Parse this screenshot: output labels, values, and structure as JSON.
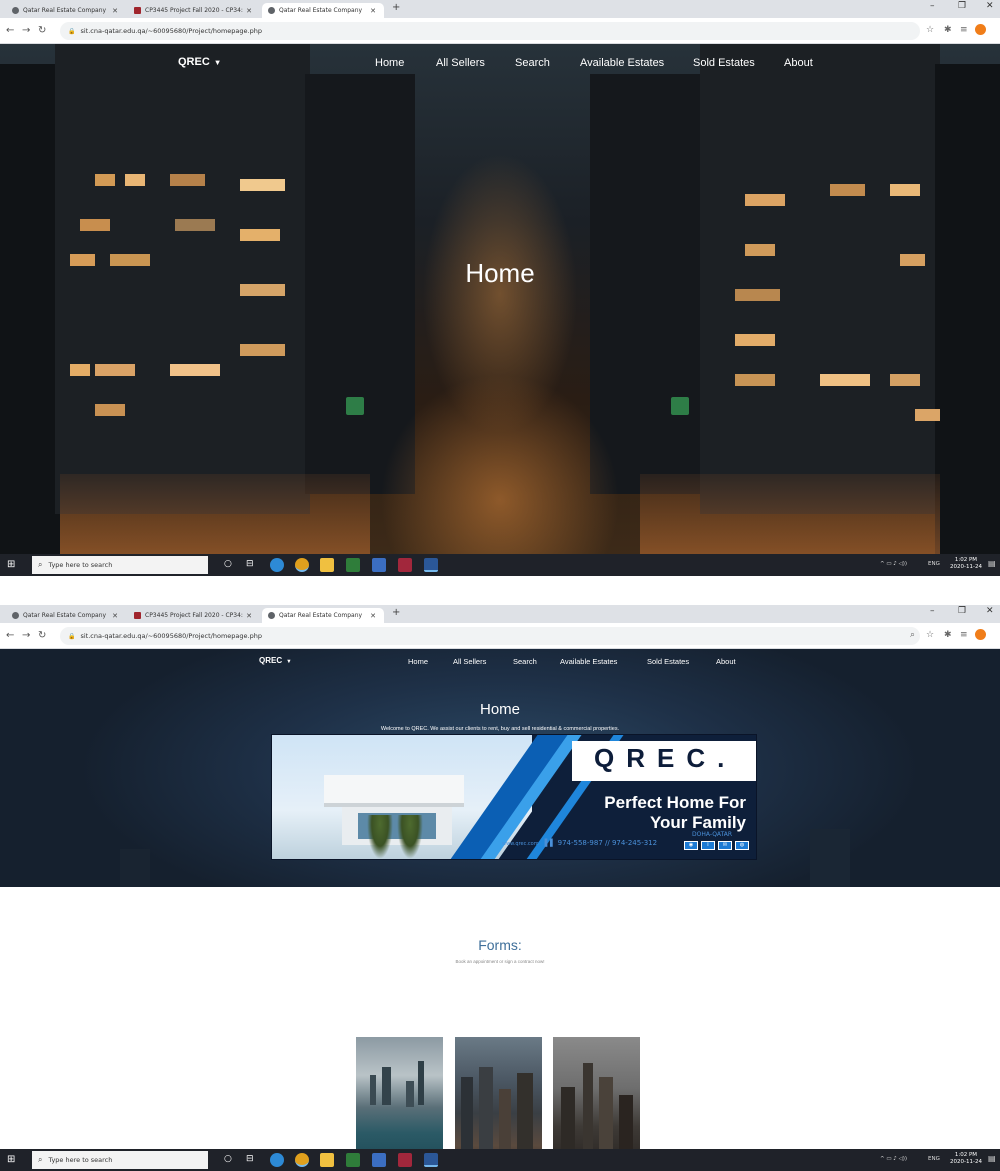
{
  "colors": {
    "tabstrip_bg": "#dee1e6",
    "taskbar_bg": "#1f2229",
    "forms_title": "#3f6f9a",
    "profile_avatar": "#f07d19",
    "banner_navy": "#0e1f3a",
    "banner_blue": "#1c7ad4"
  },
  "taskbar": {
    "search_placeholder": "Type here to search",
    "lang": "ENG"
  },
  "screens": [
    {
      "browser": {
        "tabs": [
          {
            "title": "Qatar Real Estate Company",
            "favicon": "globe-icon"
          },
          {
            "title": "CP3445 Project Fall 2020 - CP34:",
            "favicon": "mortarboard-icon"
          },
          {
            "title": "Qatar Real Estate Company",
            "favicon": "globe-icon",
            "active": true
          }
        ],
        "address": "sit.cna-qatar.edu.qa/~60095680/Project/homepage.php"
      },
      "site": {
        "brand": "QREC",
        "nav": [
          "Home",
          "All Sellers",
          "Search",
          "Available Estates",
          "Sold Estates",
          "About"
        ],
        "hero_title": "Home"
      },
      "clock": {
        "time": "1:02 PM",
        "date": "2020-11-24"
      }
    },
    {
      "browser": {
        "tabs": [
          {
            "title": "Qatar Real Estate Company",
            "favicon": "globe-icon"
          },
          {
            "title": "CP3445 Project Fall 2020 - CP34:",
            "favicon": "mortarboard-icon"
          },
          {
            "title": "Qatar Real Estate Company",
            "favicon": "globe-icon",
            "active": true
          }
        ],
        "address": "sit.cna-qatar.edu.qa/~60095680/Project/homepage.php"
      },
      "site": {
        "brand": "QREC",
        "nav": [
          "Home",
          "All Sellers",
          "Search",
          "Available Estates",
          "Sold Estates",
          "About"
        ],
        "hero_title": "Home",
        "welcome": "Welcome to QREC. We assist our clients to rent, buy and sell residential & commercial properties.",
        "banner": {
          "logo": "QREC.",
          "tagline_1": "Perfect Home For",
          "tagline_2": "Your Family",
          "contact": "974-558-987 // 974-245-312",
          "location": "DOHA-QATAR",
          "web": "www.qrec.com"
        },
        "forms_title": "Forms:",
        "forms_subtitle": "Book an appointment or sign a contract now!"
      },
      "clock": {
        "time": "1:02 PM",
        "date": "2020-11-24"
      }
    }
  ]
}
